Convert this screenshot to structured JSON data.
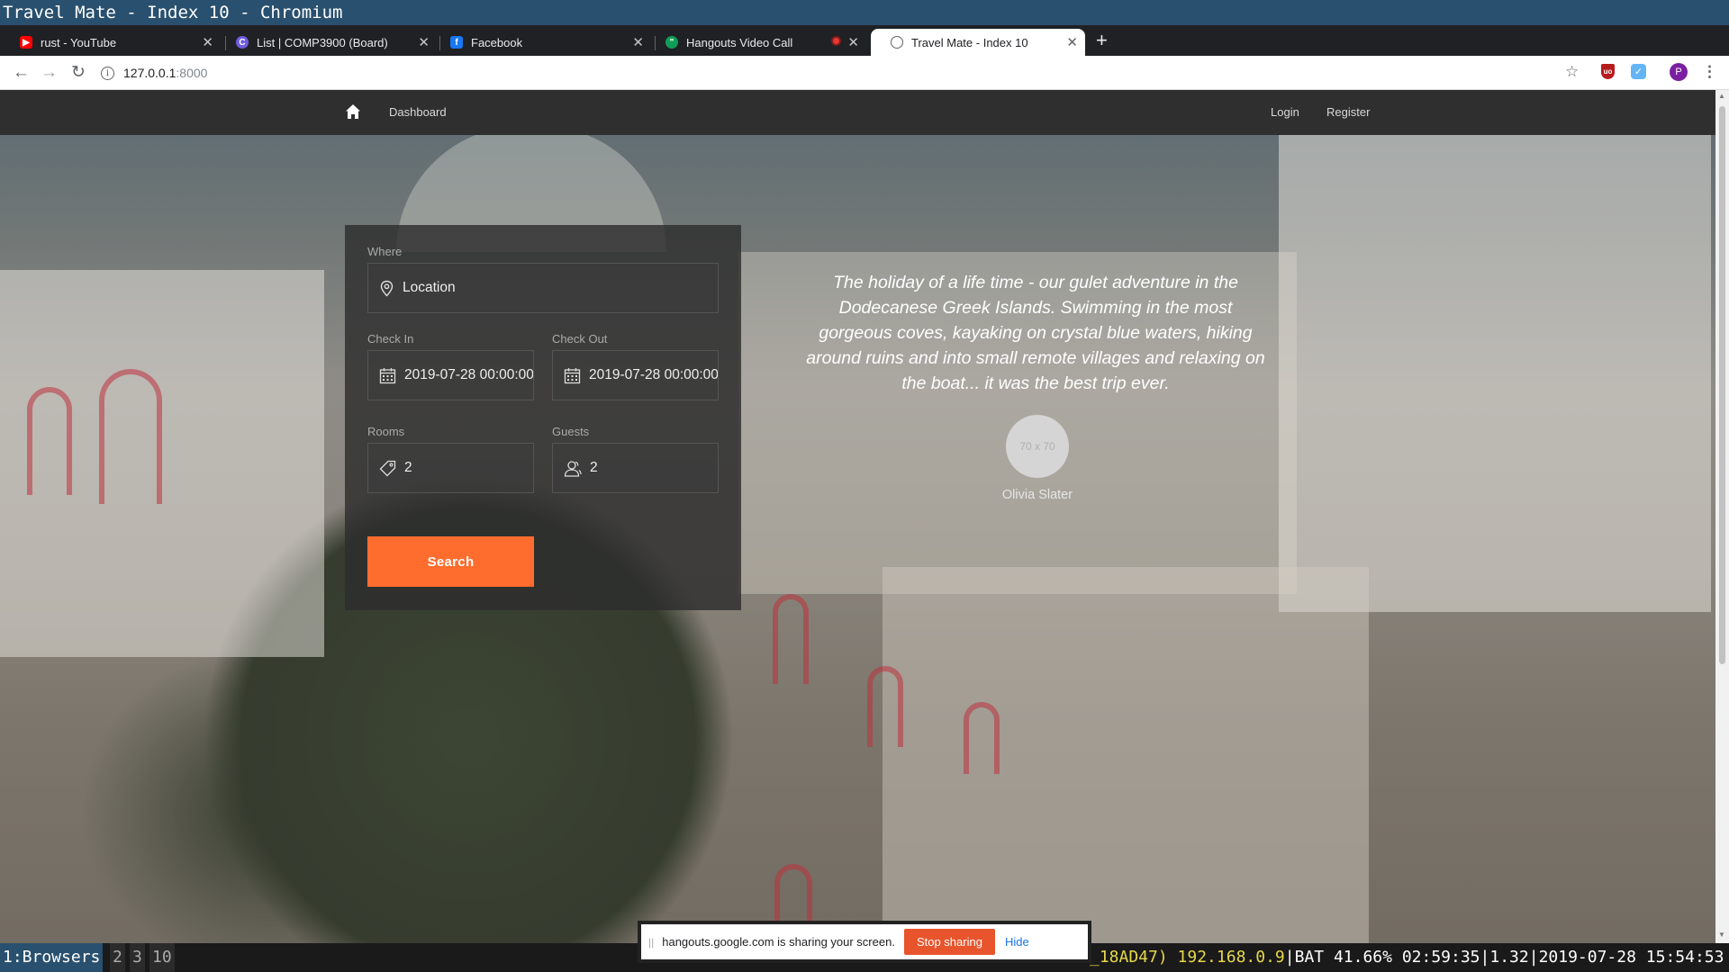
{
  "window": {
    "title": "Travel Mate - Index 10 - Chromium"
  },
  "tabs": [
    {
      "label": "rust - YouTube",
      "icon": "youtube-icon",
      "color": "#ff0000"
    },
    {
      "label": "List | COMP3900 (Board)",
      "icon": "board-icon",
      "color": "#6f5ce0"
    },
    {
      "label": "Facebook",
      "icon": "facebook-icon",
      "color": "#1877f2"
    },
    {
      "label": "Hangouts Video Call",
      "icon": "hangouts-icon",
      "color": "#0f9d58"
    },
    {
      "label": "Travel Mate - Index 10",
      "icon": "globe-icon",
      "color": "#5f6368"
    }
  ],
  "toolbar": {
    "url_host": "127.0.0.1",
    "url_port": ":8000"
  },
  "navbar": {
    "dashboard": "Dashboard",
    "login": "Login",
    "register": "Register"
  },
  "search": {
    "where_label": "Where",
    "location_placeholder": "Location",
    "checkin_label": "Check In",
    "checkin_value": "2019-07-28 00:00:00",
    "checkout_label": "Check Out",
    "checkout_value": "2019-07-28 00:00:00",
    "rooms_label": "Rooms",
    "rooms_value": "2",
    "guests_label": "Guests",
    "guests_value": "2",
    "button_label": "Search",
    "accent": "#ff6d2e"
  },
  "testimonial": {
    "quote": "The holiday of a life time - our gulet adventure in the Dodecanese Greek Islands. Swimming in the most gorgeous coves, kayaking on crystal blue waters, hiking around ruins and into small remote villages and relaxing on the boat... it was the best trip ever.",
    "avatar_placeholder": "70 x 70",
    "author": "Olivia Slater"
  },
  "sharing": {
    "message": "hangouts.google.com is sharing your screen.",
    "stop_label": "Stop sharing",
    "hide_label": "Hide"
  },
  "statusbar": {
    "workspaces": [
      "1:Browsers",
      "2",
      "3",
      "10"
    ],
    "mac_fragment": "_18AD47)",
    "ip": "192.168.0.9",
    "battery": "BAT 41.66% 02:59:35",
    "load": "1.32",
    "datetime": "2019-07-28 15:54:53"
  }
}
